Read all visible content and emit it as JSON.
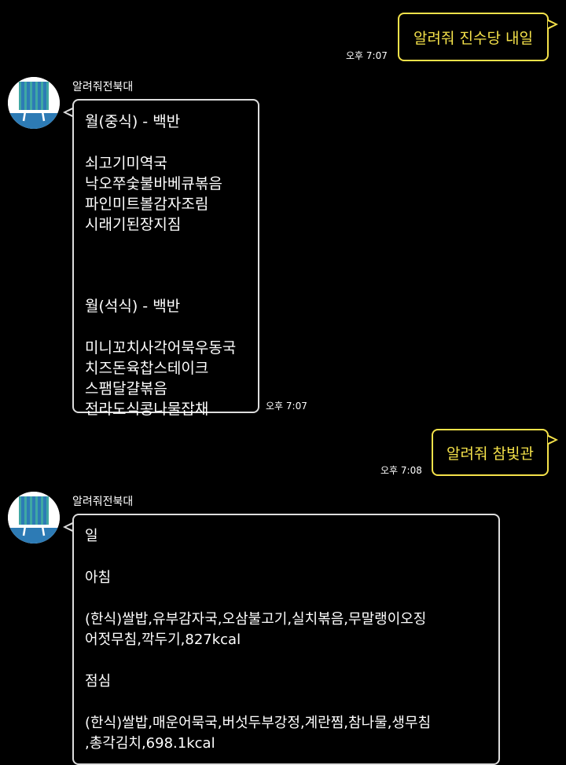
{
  "colors": {
    "background": "#000000",
    "user_bubble_border": "#f5e24a",
    "user_text": "#f5e24a",
    "bot_bubble_border": "#dddddd",
    "avatar_blue": "#2d7bb5",
    "avatar_teal": "#3fa8a3"
  },
  "messages": [
    {
      "type": "outgoing",
      "text": "알려줘 진수당 내일",
      "time": "오후 7:07"
    },
    {
      "type": "incoming",
      "sender": "알려줘전북대",
      "avatar_icon": "university-building-icon",
      "time": "오후 7:07",
      "lines": [
        "월(중식) - 백반",
        "",
        "쇠고기미역국",
        "낙오쭈숯불바베큐볶음",
        "파인미트볼감자조림",
        "시래기된장지짐",
        "",
        "",
        "월(석식) - 백반",
        "",
        "미니꼬치사각어묵우동국",
        "치즈돈육찹스테이크",
        "스팸달걀볶음",
        "전라도식콩나물잡채"
      ]
    },
    {
      "type": "outgoing",
      "text": "알려줘 참빛관",
      "time": "오후 7:08"
    },
    {
      "type": "incoming",
      "sender": "알려줘전북대",
      "avatar_icon": "university-building-icon",
      "lines": [
        "일",
        "",
        "아침",
        "",
        "(한식)쌀밥,유부감자국,오삼불고기,실치볶음,무말랭이오징",
        "어젓무침,깍두기,827kcal",
        "",
        "점심",
        "",
        "(한식)쌀밥,매운어묵국,버섯두부강정,계란찜,참나물,생무침",
        ",총각김치,698.1kcal"
      ]
    }
  ]
}
